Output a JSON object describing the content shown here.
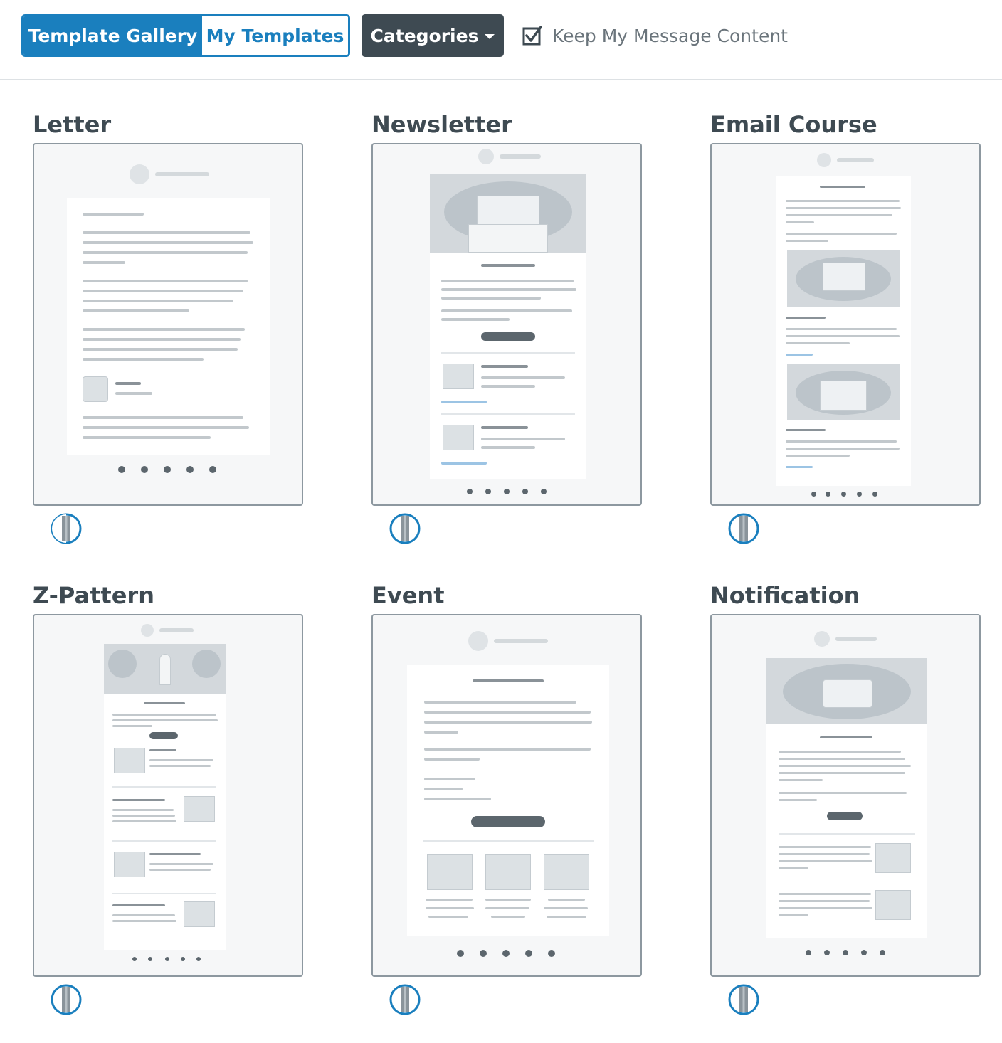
{
  "toolbar": {
    "template_gallery_label": "Template Gallery",
    "my_templates_label": "My Templates",
    "categories_label": "Categories",
    "keep_content_label": "Keep My Message Content",
    "keep_content_checked": true,
    "colors": {
      "accent": "#1a7fbe",
      "dark_button": "#3e4a52"
    }
  },
  "templates": [
    {
      "name": "Letter"
    },
    {
      "name": "Newsletter"
    },
    {
      "name": "Email Course"
    },
    {
      "name": "Z-Pattern"
    },
    {
      "name": "Event"
    },
    {
      "name": "Notification"
    }
  ]
}
